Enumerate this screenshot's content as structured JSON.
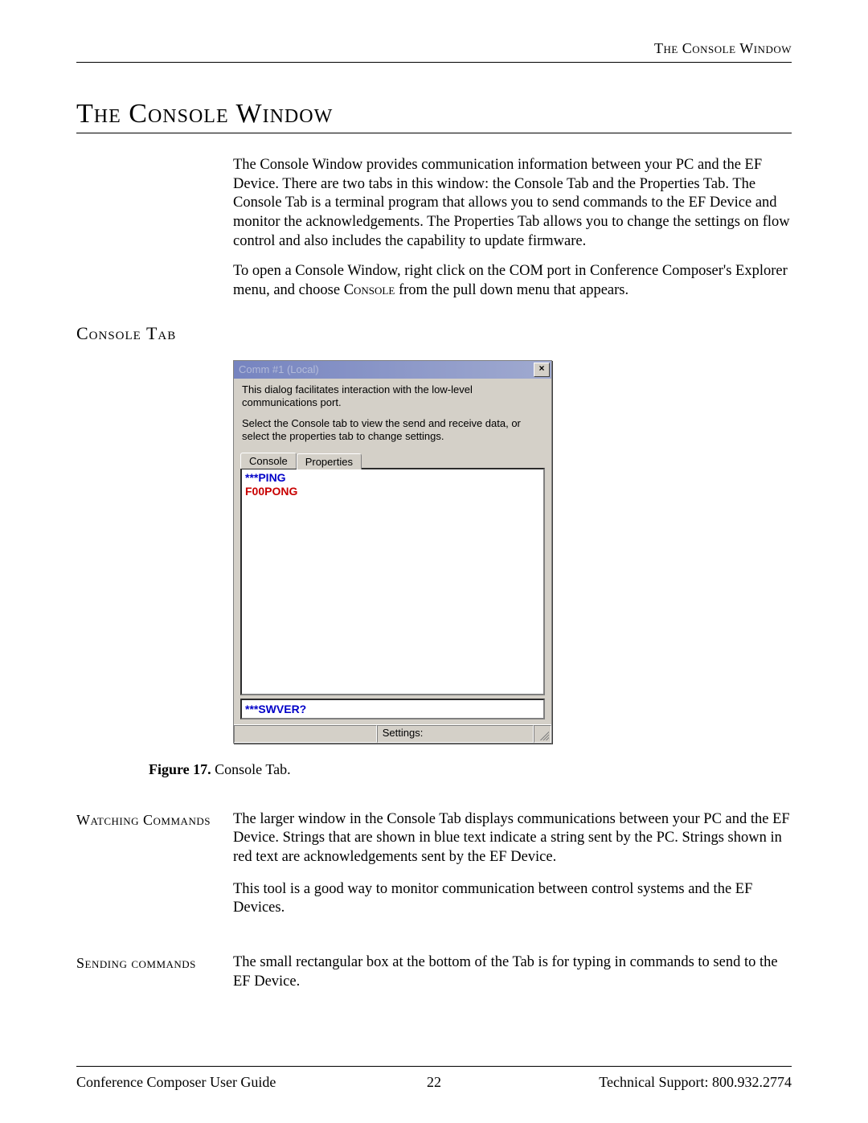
{
  "header": {
    "running": "The Console Window"
  },
  "title": "The Console Window",
  "intro_p1": "The Console Window provides communication information between your PC and the EF Device.  There are two tabs in this window: the Console Tab and the Properties Tab.  The Console Tab is a terminal program that allows you to send commands to the EF Device and monitor the acknowledgements.  The Properties Tab allows you to change the settings on flow control and also includes the capability to update firmware.",
  "intro_p2_a": "To open a Console Window,  right click on the COM port in Conference Composer's Explorer menu, and choose ",
  "intro_p2_b": "Console",
  "intro_p2_c": " from the pull down menu that appears.",
  "section": "Console Tab",
  "dialog": {
    "title": "Comm #1 (Local)",
    "help1": "This dialog facilitates interaction with the low-level communications port.",
    "help2": "Select the Console tab to view the send and receive data, or select the properties tab to change settings.",
    "tabs": {
      "console": "Console",
      "properties": "Properties"
    },
    "lines": [
      {
        "text": "***PING",
        "cls": "blue"
      },
      {
        "text": "F00PONG",
        "cls": "red"
      }
    ],
    "input_value": "***SWVER?",
    "status_label": "Settings:"
  },
  "caption": {
    "label": "Figure 17.",
    "text": " Console Tab."
  },
  "watching": {
    "label": "Watching Commands",
    "p1": "The larger window in the Console Tab displays communications between your PC and the EF Device.  Strings that are shown in blue text indicate a string sent by the PC.  Strings shown in red text are acknowledgements sent by the EF Device.",
    "p2": "This tool is a good way to monitor communication between control systems and the EF Devices."
  },
  "sending": {
    "label": "Sending commands",
    "p1": "The small rectangular box at the bottom of the Tab is for typing in commands to send to the EF Device."
  },
  "footer": {
    "left": "Conference Composer User Guide",
    "center": "22",
    "right": "Technical Support: 800.932.2774"
  }
}
